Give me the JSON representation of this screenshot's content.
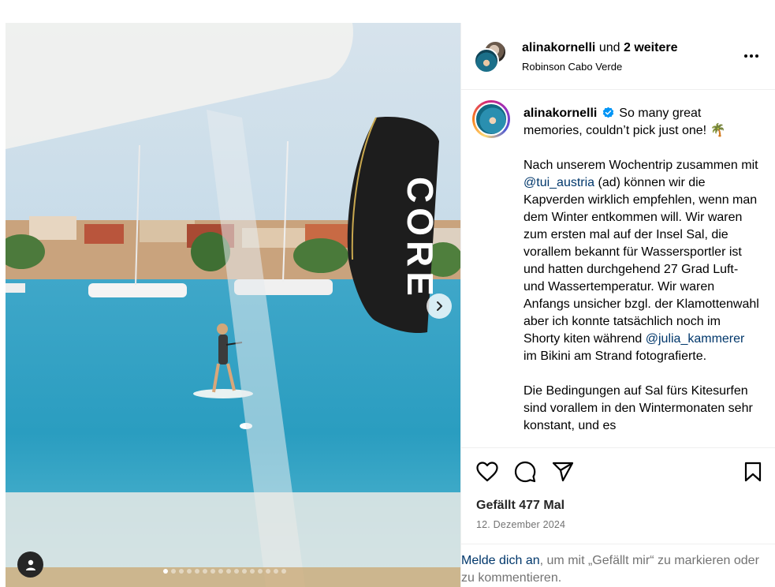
{
  "post": {
    "header": {
      "username": "alinakornelli",
      "connector": "und",
      "others": "2 weitere",
      "location": "Robinson Cabo Verde"
    },
    "caption": {
      "username": "alinakornelli",
      "line1": "So many great memories, couldn’t pick just one! 🌴",
      "p2_a": "Nach unserem Wochentrip zusammen mit ",
      "p2_mention": "@tui_austria",
      "p2_b": " (ad) können wir die Kapverden wirklich empfehlen, wenn man dem Winter entkommen will. Wir waren zum ersten mal auf der Insel Sal, die vorallem bekannt für Wassersportler ist und hatten durchgehend 27 Grad Luft- und Wassertemperatur. Wir waren Anfangs unsicher bzgl. der Klamottenwahl aber ich konnte tatsächlich noch im Shorty kiten während ",
      "p2_mention2": "@julia_kammerer",
      "p2_c": " im Bikini am Strand fotografierte.",
      "p3": "Die Bedingungen auf Sal fürs Kitesurfen sind vorallem in den Wintermonaten sehr konstant, und es"
    },
    "likes": "Gefällt 477 Mal",
    "date": "12. Dezember 2024",
    "login": {
      "link": "Melde dich an",
      "rest": ", um mit „Gefällt mir“ zu markieren oder zu kommentieren."
    },
    "media": {
      "kite_brand": "CORE",
      "carousel_total": 16,
      "carousel_active_index": 0
    }
  },
  "icons": {
    "more": "more-horizontal-icon",
    "like": "heart-icon",
    "comment": "comment-icon",
    "share": "send-icon",
    "save": "bookmark-icon",
    "next": "chevron-right-icon",
    "tag": "user-tag-icon",
    "verified": "verified-badge-icon"
  },
  "colors": {
    "mention": "#00376b",
    "muted": "#737373",
    "verified": "#0095f6"
  }
}
